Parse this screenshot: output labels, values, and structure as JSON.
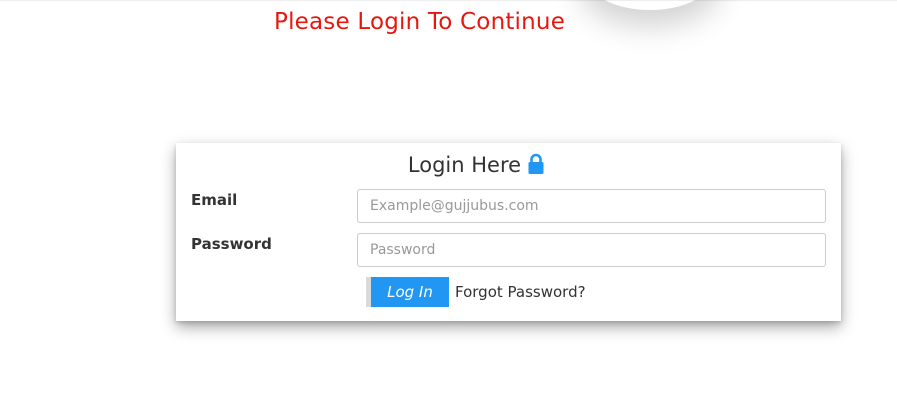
{
  "notice": {
    "text": "Please Login To Continue",
    "color": "#e8170e"
  },
  "login_card": {
    "title": "Login Here",
    "title_icon": "lock-icon",
    "accent_color": "#2196f3",
    "email": {
      "label": "Email",
      "value": "",
      "placeholder": "Example@gujjubus.com"
    },
    "password": {
      "label": "Password",
      "value": "",
      "placeholder": "Password"
    },
    "login_button_label": "Log In",
    "forgot_password_label": "Forgot Password?"
  }
}
